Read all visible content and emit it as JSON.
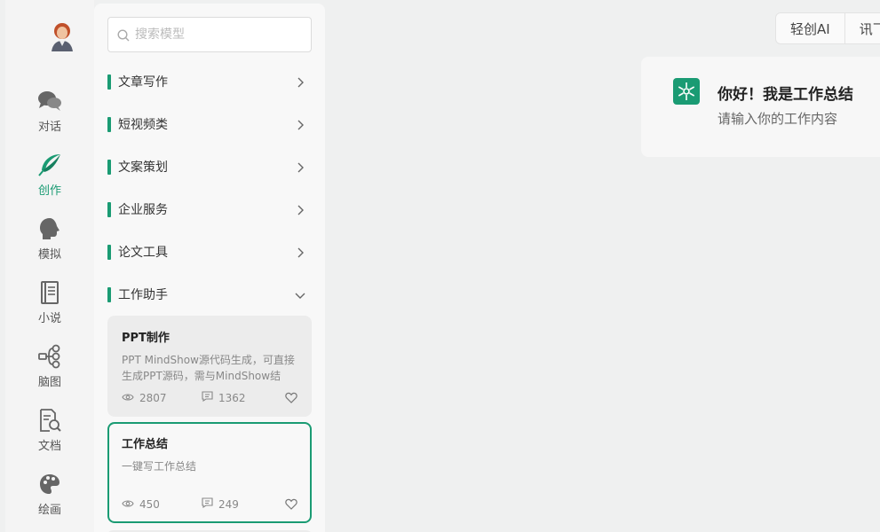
{
  "sidebar": {
    "items": [
      {
        "label": "对话",
        "icon": "chat-bubbles-icon"
      },
      {
        "label": "创作",
        "icon": "feather-quill-icon",
        "active": true
      },
      {
        "label": "模拟",
        "icon": "head-profile-icon"
      },
      {
        "label": "小说",
        "icon": "book-icon"
      },
      {
        "label": "脑图",
        "icon": "mindmap-icon"
      },
      {
        "label": "文档",
        "icon": "document-search-icon"
      },
      {
        "label": "绘画",
        "icon": "palette-icon"
      }
    ]
  },
  "search": {
    "placeholder": "搜索模型"
  },
  "categories": [
    {
      "label": "文章写作",
      "expanded": false
    },
    {
      "label": "短视频类",
      "expanded": false
    },
    {
      "label": "文案策划",
      "expanded": false
    },
    {
      "label": "企业服务",
      "expanded": false
    },
    {
      "label": "论文工具",
      "expanded": false
    },
    {
      "label": "工作助手",
      "expanded": true
    }
  ],
  "cards": [
    {
      "title": "PPT制作",
      "desc": "PPT MindShow源代码生成，可直接生成PPT源码，需与MindShow结",
      "views": "2807",
      "comments": "1362"
    },
    {
      "title": "工作总结",
      "desc": "一键写工作总结",
      "views": "450",
      "comments": "249",
      "selected": true
    }
  ],
  "topbar": {
    "buttons": [
      "轻创AI",
      "讯飞"
    ]
  },
  "greeting": {
    "title": "你好！我是工作总结",
    "subtitle": "请输入你的工作内容",
    "icon": "asterisk-logo-icon"
  },
  "colors": {
    "accent": "#1a9b73",
    "background": "#eff0f0"
  }
}
